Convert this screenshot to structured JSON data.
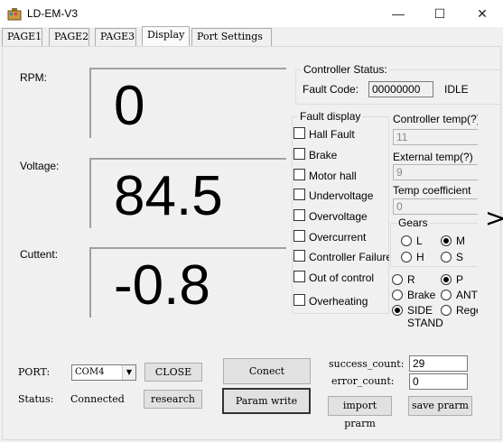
{
  "window": {
    "title": "LD-EM-V3"
  },
  "tabs": [
    "PAGE1",
    "PAGE2",
    "PAGE3",
    "Display",
    "Port Settings"
  ],
  "readouts": {
    "rpm_label": "RPM:",
    "rpm_value": "0",
    "voltage_label": "Voltage:",
    "voltage_value": "84.5",
    "current_label": "Cuttent:",
    "current_value": "-0.8"
  },
  "controller_status": {
    "legend": "Controller Status:",
    "fault_code_label": "Fault Code:",
    "fault_code_value": "00000000",
    "state": "IDLE"
  },
  "fault_display": {
    "legend": "Fault display",
    "items": [
      "Hall Fault",
      "Brake",
      "Motor hall",
      "Undervoltage",
      "Overvoltage",
      "Overcurrent",
      "Controller Failure",
      "Out of control",
      "Overheating"
    ]
  },
  "temps": {
    "controller_label": "Controller temp(?)",
    "controller_value": "11",
    "external_label": "External temp(?)",
    "external_value": "9",
    "coefficient_label": "Temp coefficient",
    "coefficient_value": "0"
  },
  "gears": {
    "legend": "Gears",
    "options": [
      "L",
      "M",
      "H",
      "S"
    ],
    "selected": "M"
  },
  "modes": {
    "options": [
      "R",
      "P",
      "Brake",
      "ANTI",
      "SIDE STAND",
      "Regen"
    ],
    "selected": [
      "P",
      "SIDE STAND"
    ]
  },
  "port": {
    "port_label": "PORT:",
    "port_value": "COM4",
    "close_label": "CLOSE",
    "status_label": "Status:",
    "status_value": "Connected",
    "research_label": "research"
  },
  "actions": {
    "connect_label": "Conect",
    "param_write_label": "Param write",
    "import_label": "import prarm",
    "save_label": "save prarm"
  },
  "counts": {
    "success_label": "success_count:",
    "success_value": "29",
    "error_label": "error_count:",
    "error_value": "0"
  }
}
